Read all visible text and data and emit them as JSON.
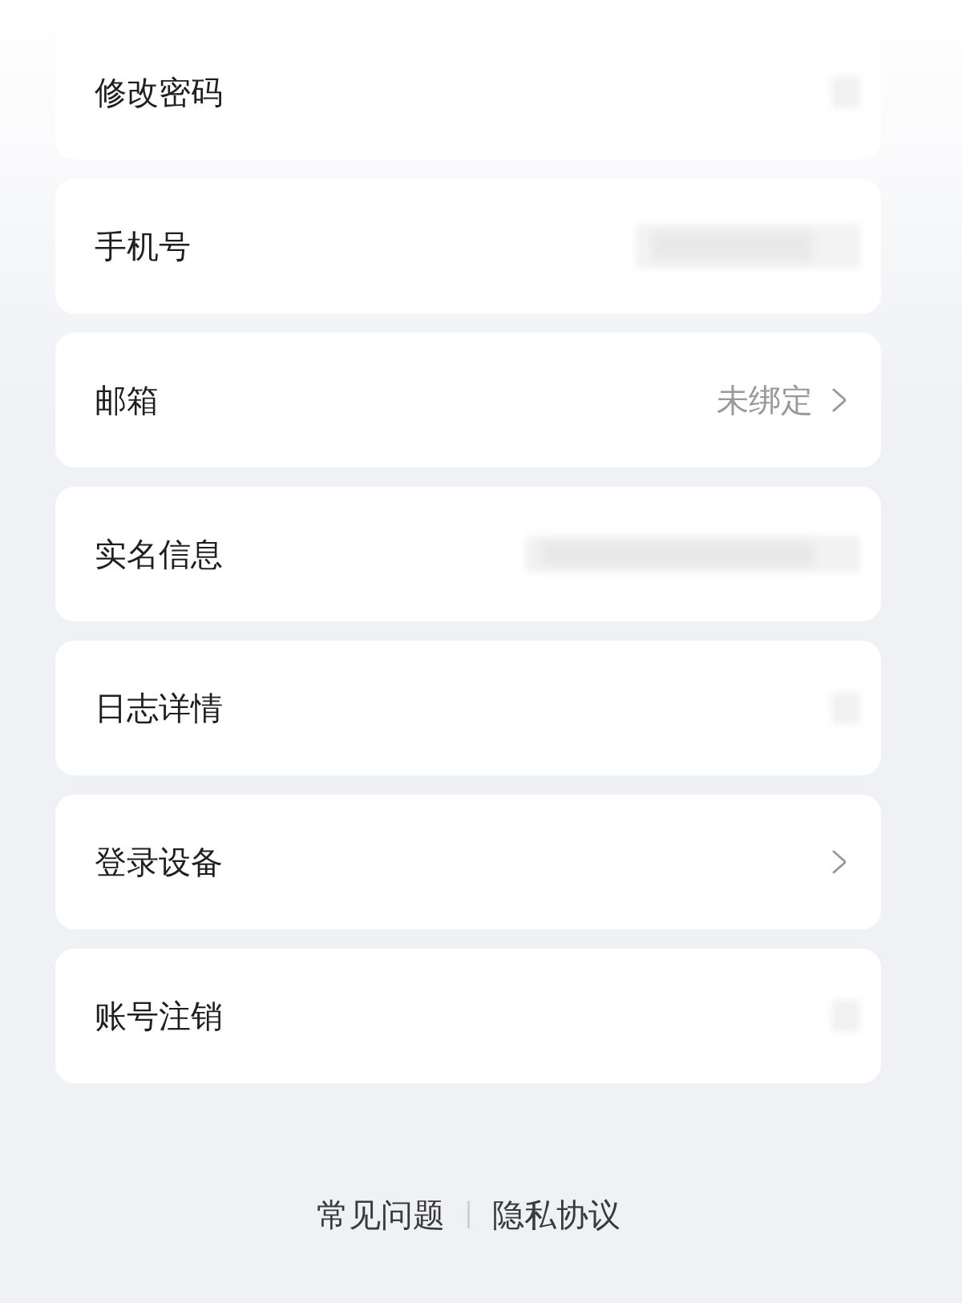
{
  "settings_rows": [
    {
      "label": "修改密码",
      "chevron": false,
      "kind": "blur_icon"
    },
    {
      "label": "手机号",
      "chevron": false,
      "kind": "blur_medium"
    },
    {
      "label": "邮箱",
      "value": "未绑定",
      "chevron": true,
      "kind": "link"
    },
    {
      "label": "实名信息",
      "chevron": false,
      "kind": "blur_long"
    },
    {
      "label": "日志详情",
      "chevron": false,
      "kind": "blur_icon"
    },
    {
      "label": "登录设备",
      "chevron": true,
      "kind": "link"
    },
    {
      "label": "账号注销",
      "chevron": false,
      "kind": "blur_icon"
    }
  ],
  "footer": {
    "links": [
      {
        "label": "常见问题"
      },
      {
        "label": "隐私协议"
      }
    ]
  }
}
